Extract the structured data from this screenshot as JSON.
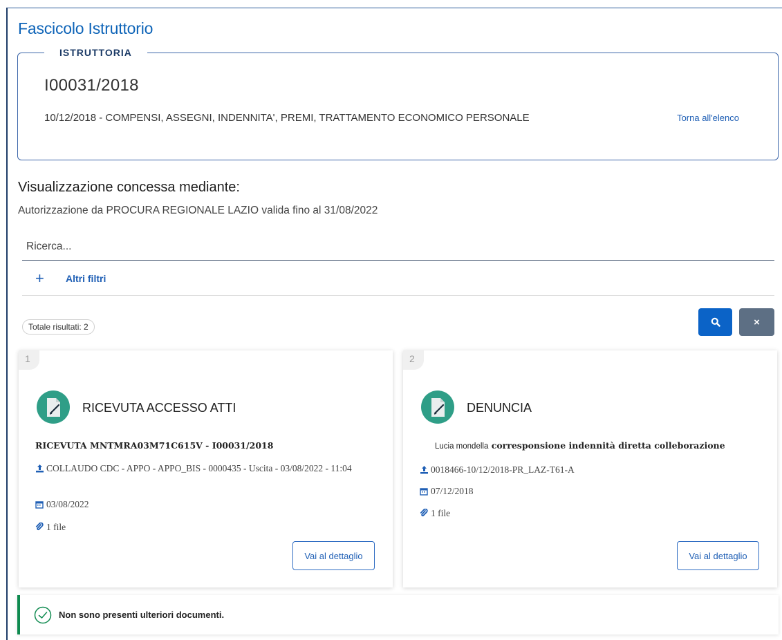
{
  "page": {
    "title": "Fascicolo Istruttorio"
  },
  "istruttoria": {
    "legend": "ISTRUTTORIA",
    "code": "I00031/2018",
    "description": "10/12/2018 - COMPENSI, ASSEGNI, INDENNITA', PREMI, TRATTAMENTO ECONOMICO PERSONALE",
    "back_link": "Torna all'elenco"
  },
  "visibility": {
    "heading": "Visualizzazione concessa mediante:",
    "subtext": "Autorizzazione da PROCURA REGIONALE LAZIO valida fino al 31/08/2022"
  },
  "search": {
    "placeholder": "Ricerca...",
    "value": ""
  },
  "filters": {
    "plus_icon": "+",
    "label": "Altri filtri"
  },
  "results": {
    "total_label": "Totale risultati: 2"
  },
  "buttons": {
    "search_icon": "search-icon",
    "clear_label": "×"
  },
  "cards": [
    {
      "index": "1",
      "title": "RICEVUTA ACCESSO ATTI",
      "subtitle_plain": "",
      "subtitle_bold": "RICEVUTA MNTMRA03M71C615V - I00031/2018",
      "protocol": "COLLAUDO CDC - APPO - APPO_BIS - 0000435 - Uscita - 03/08/2022 - 11:04",
      "date": "03/08/2022",
      "files": "1 file",
      "detail_label": "Vai al dettaglio"
    },
    {
      "index": "2",
      "title": "DENUNCIA",
      "subtitle_plain": "Lucia mondella",
      "subtitle_bold": "corresponsione indennità diretta colleborazione",
      "protocol": "0018466-10/12/2018-PR_LAZ-T61-A",
      "date": "07/12/2018",
      "files": "1 file",
      "detail_label": "Vai al dettaglio"
    }
  ],
  "notice": {
    "text": "Non sono presenti ulteriori documenti."
  },
  "colors": {
    "primary": "#0b63c7",
    "title_blue": "#0e64b8",
    "clear_button": "#5d6f84",
    "success": "#0e8a4f",
    "icon_teal": "#2f9e87"
  }
}
